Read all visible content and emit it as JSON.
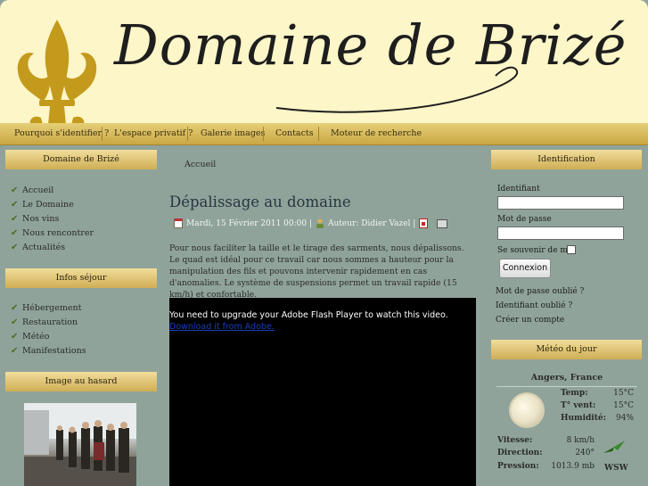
{
  "header": {
    "title": "Domaine de Brizé"
  },
  "nav": [
    "Pourquoi s'identifier ?",
    "L'espace privatif ?",
    "Galerie images",
    "Contacts",
    "Moteur de recherche"
  ],
  "left": {
    "block1_title": "Domaine de Brizé",
    "block1_items": [
      "Accueil",
      "Le Domaine",
      "Nos vins",
      "Nous rencontrer",
      "Actualités"
    ],
    "block2_title": "Infos séjour",
    "block2_items": [
      "Hébergement",
      "Restauration",
      "Météo",
      "Manifestations"
    ],
    "block3_title": "Image au hasard"
  },
  "main": {
    "breadcrumb": "Accueil",
    "title": "Dépalissage au domaine",
    "date": "Mardi, 15 Février 2011 00:00 |",
    "author": "Auteur: Didier Vazel |",
    "body": "Pour nous faciliter la taille et le tirage des sarments, nous dépalissons. Le quad est idéal pour ce travail car nous sommes a hauteur pour la manipulation des fils et pouvons intervenir rapidement en cas d'anomalies. Le système de suspensions permet un travail rapide (15 km/h) et confortable.",
    "video_message": "You need to upgrade your Adobe Flash Player to watch this video.",
    "video_link": "Download it from Adobe."
  },
  "login": {
    "title": "Identification",
    "username_label": "Identifiant",
    "password_label": "Mot de passe",
    "remember_label": "Se souvenir de moi",
    "button": "Connexion",
    "forgot_password": "Mot de passe oublié ?",
    "forgot_username": "Identifiant oublié ?",
    "create_account": "Créer un compte"
  },
  "weather": {
    "title": "Météo du jour",
    "city": "Angers, France",
    "temp_label": "Temp:",
    "temp": "15°C",
    "feel_label": "T° vent:",
    "feel": "15°C",
    "humidity_label": "Humidité:",
    "humidity": "94%",
    "wind_label": "Vitesse:",
    "wind": "8 km/h",
    "direction_label": "Direction:",
    "direction": "240°",
    "pressure_label": "Pression:",
    "pressure": "1013.9 mb",
    "wind_dir": "WSW"
  },
  "colors": {
    "background": "#8fa39a",
    "header": "#fdf6c8",
    "nav": "#d4b455",
    "accent_gold": "#c8a23a"
  }
}
